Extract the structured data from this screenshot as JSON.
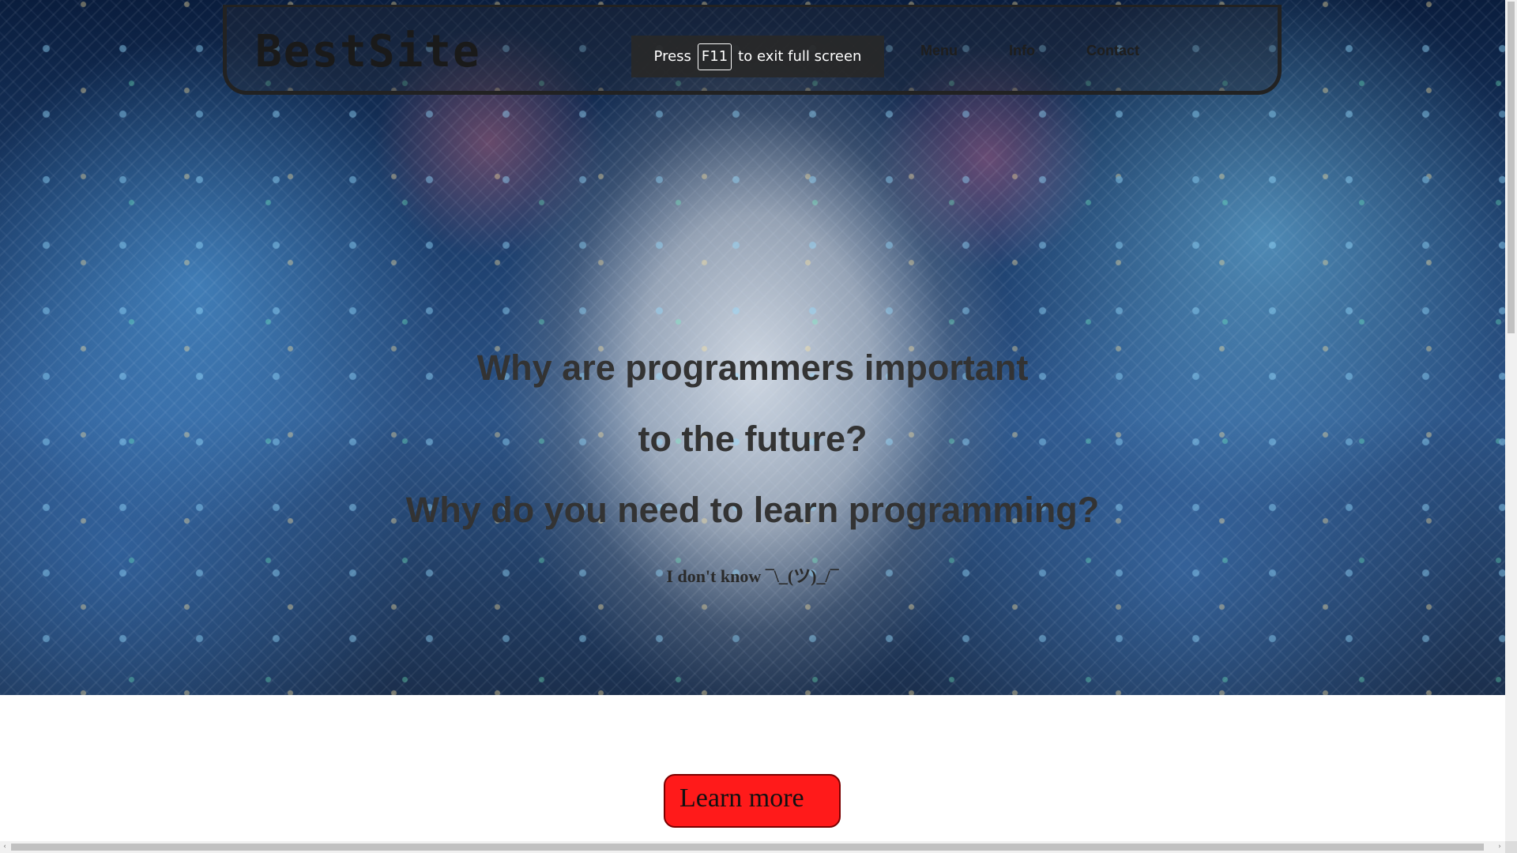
{
  "header": {
    "logo": "BestSite",
    "nav": {
      "menu": "Menu",
      "info": "Info",
      "contact": "Contact"
    }
  },
  "fullscreen_notice": {
    "prefix": "Press",
    "key": "F11",
    "suffix": "to exit full screen"
  },
  "hero": {
    "line1": "Why are programmers important",
    "line2": "to the future?",
    "line3": "Why do you need to learn programming?",
    "line4": "I don't know ¯\\_(ツ)_/¯"
  },
  "cta": {
    "label": "Learn more"
  },
  "scroll": {
    "left_arrow": "‹",
    "right_arrow": "›"
  },
  "colors": {
    "button": "#ff1a1a",
    "hero_text": "#333333"
  }
}
